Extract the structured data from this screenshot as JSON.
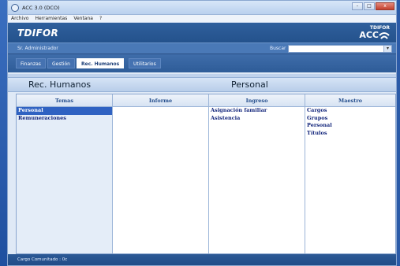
{
  "window": {
    "title": "ACC 3.0 (DCO)",
    "minimize": "-",
    "maximize": "□",
    "close": "x"
  },
  "menu": [
    "Archivo",
    "Herramientas",
    "Ventana",
    "?"
  ],
  "brand": {
    "name": "TDIFOR",
    "logo_top": "TDIFOR",
    "logo_main": "ACC"
  },
  "userbar": {
    "user": "Sr. Administrador",
    "search_label": "Buscar",
    "search_value": ""
  },
  "tabs": [
    {
      "label": "Finanzas",
      "active": false
    },
    {
      "label": "Gestión",
      "active": false
    },
    {
      "label": "Rec. Humanos",
      "active": true
    },
    {
      "label": "Utilitarios",
      "active": false
    }
  ],
  "header": {
    "module": "Rec. Humanos",
    "page": "Personal"
  },
  "columns": [
    {
      "title": "Temas",
      "items": [
        "Personal",
        "Remuneraciones"
      ],
      "selected": 0
    },
    {
      "title": "Informe",
      "items": [],
      "selected": -1
    },
    {
      "title": "Ingreso",
      "items": [
        "Asignación familiar",
        "Asistencia"
      ],
      "selected": -1
    },
    {
      "title": "Maestro",
      "items": [
        "Cargos",
        "Grupos",
        "Personal",
        "Títulos"
      ],
      "selected": -1
    }
  ],
  "status": "Cargo Comunitado : 0c"
}
